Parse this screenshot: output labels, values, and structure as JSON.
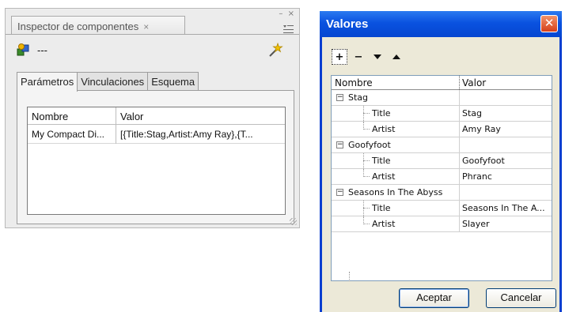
{
  "inspector": {
    "panel_title": "Inspector de componentes",
    "tab_close_glyph": "×",
    "minimize_glyph": "–",
    "close_glyph": "×",
    "component_name": "---",
    "tabs": [
      {
        "label": "Parámetros",
        "active": true
      },
      {
        "label": "Vinculaciones",
        "active": false
      },
      {
        "label": "Esquema",
        "active": false
      }
    ],
    "grid": {
      "col_name": "Nombre",
      "col_value": "Valor",
      "rows": [
        {
          "name": "My Compact Di...",
          "value": "[{Title:Stag,Artist:Amy Ray},{T..."
        }
      ]
    }
  },
  "valores": {
    "title": "Valores",
    "close_glyph": "✕",
    "toolbar": {
      "add": "+",
      "remove": "−"
    },
    "grid": {
      "col_name": "Nombre",
      "col_value": "Valor",
      "groups": [
        {
          "label": "Stag",
          "children": [
            {
              "key": "Title",
              "value": "Stag"
            },
            {
              "key": "Artist",
              "value": "Amy Ray"
            }
          ]
        },
        {
          "label": "Goofyfoot",
          "children": [
            {
              "key": "Title",
              "value": "Goofyfoot"
            },
            {
              "key": "Artist",
              "value": "Phranc"
            }
          ]
        },
        {
          "label": "Seasons In The Abyss",
          "children": [
            {
              "key": "Title",
              "value": "Seasons In The A..."
            },
            {
              "key": "Artist",
              "value": "Slayer"
            }
          ]
        }
      ],
      "expander_glyph": "−"
    },
    "ok_label": "Aceptar",
    "cancel_label": "Cancelar"
  },
  "colors": {
    "xp_title_blue": "#0a52e0",
    "xp_face": "#ece9d8",
    "panel_gray": "#ececec",
    "close_red": "#d6401a"
  },
  "icons": [
    "component-icon",
    "wand-icon",
    "panel-menu-icon"
  ]
}
